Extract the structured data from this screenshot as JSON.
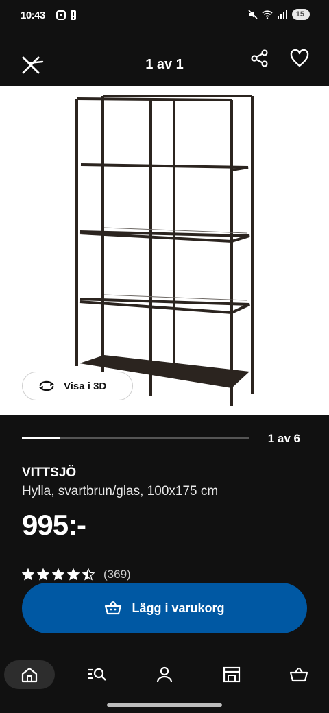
{
  "status_bar": {
    "time": "10:43",
    "battery": "15",
    "icons": [
      "screenshot-icon",
      "alert-icon",
      "mute-icon",
      "wifi-icon",
      "signal-icon"
    ]
  },
  "top_bar": {
    "title": "1 av 1",
    "close_icon": "close-icon",
    "share_icon": "share-icon",
    "favorite_icon": "heart-icon"
  },
  "image": {
    "view_3d_label": "Visa i 3D",
    "view_3d_icon": "rotate-icon"
  },
  "gallery": {
    "progress_fraction": 0.167,
    "page_count": "1 av 6"
  },
  "product": {
    "name": "VITTSJÖ",
    "description": "Hylla, svartbrun/glas, 100x175 cm",
    "price": "995:-",
    "rating_value": 4.5,
    "rating_max": 5,
    "review_count": "(369)"
  },
  "cart": {
    "label": "Lägg i varukorg",
    "icon": "basket-icon"
  },
  "bottom_nav": {
    "items": [
      {
        "icon": "home-icon",
        "active": true
      },
      {
        "icon": "search-list-icon",
        "active": false
      },
      {
        "icon": "profile-icon",
        "active": false
      },
      {
        "icon": "store-icon",
        "active": false
      },
      {
        "icon": "cart-icon",
        "active": false
      }
    ]
  },
  "colors": {
    "background": "#111111",
    "accent_blue": "#0058a3",
    "white": "#ffffff"
  }
}
